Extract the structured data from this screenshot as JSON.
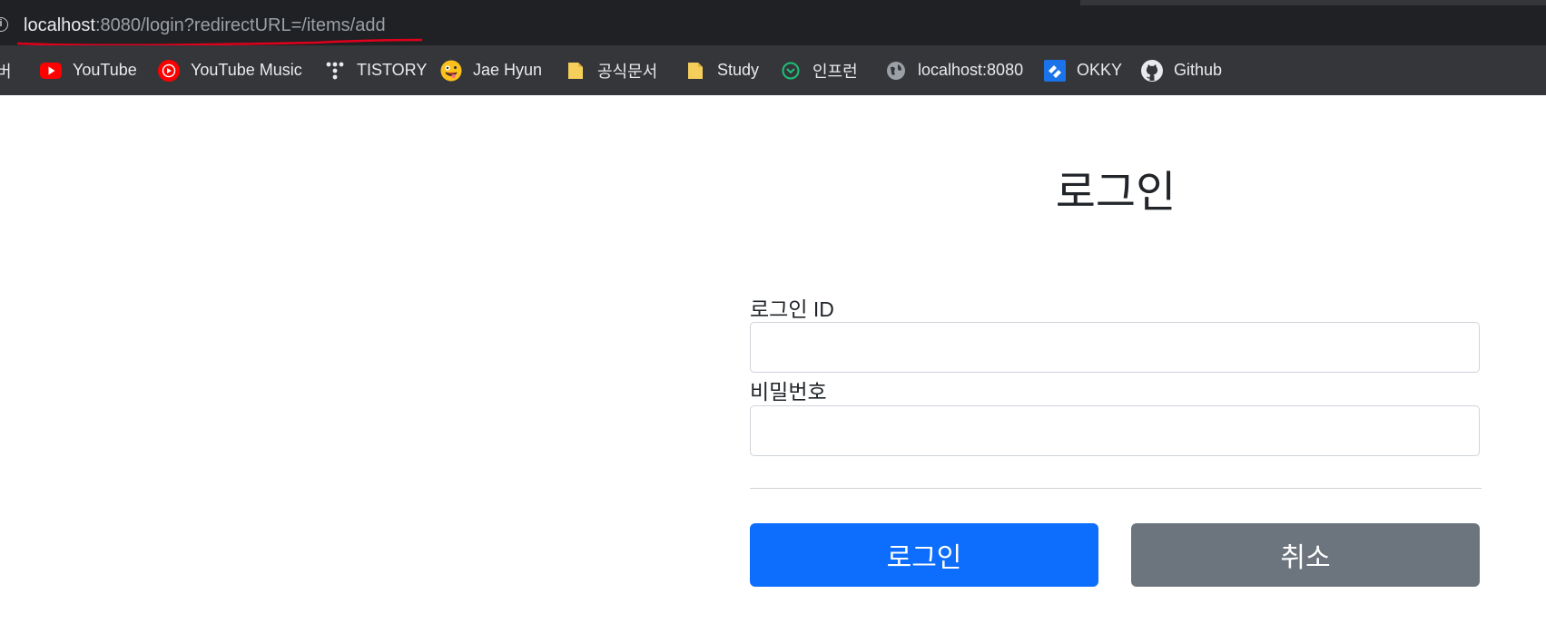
{
  "browser": {
    "url_host": "localhost",
    "url_rest": ":8080/login?redirectURL=/items/add"
  },
  "bookmarks": [
    {
      "label": "버",
      "icon": "naver-icon"
    },
    {
      "label": "YouTube",
      "icon": "youtube-icon"
    },
    {
      "label": "YouTube Music",
      "icon": "youtube-music-icon"
    },
    {
      "label": "TISTORY",
      "icon": "tistory-icon"
    },
    {
      "label": "Jae Hyun",
      "icon": "emoji-face-icon"
    },
    {
      "label": "공식문서",
      "icon": "folder-icon"
    },
    {
      "label": "Study",
      "icon": "folder-icon"
    },
    {
      "label": "인프런",
      "icon": "inflearn-icon"
    },
    {
      "label": "localhost:8080",
      "icon": "globe-icon"
    },
    {
      "label": "OKKY",
      "icon": "okky-icon"
    },
    {
      "label": "Github",
      "icon": "github-icon"
    }
  ],
  "login": {
    "title": "로그인",
    "id_label": "로그인 ID",
    "id_value": "",
    "password_label": "비밀번호",
    "password_value": "",
    "submit_label": "로그인",
    "cancel_label": "취소"
  },
  "colors": {
    "primary": "#0d6efd",
    "secondary": "#6c757d",
    "annotation": "#e0001b"
  }
}
